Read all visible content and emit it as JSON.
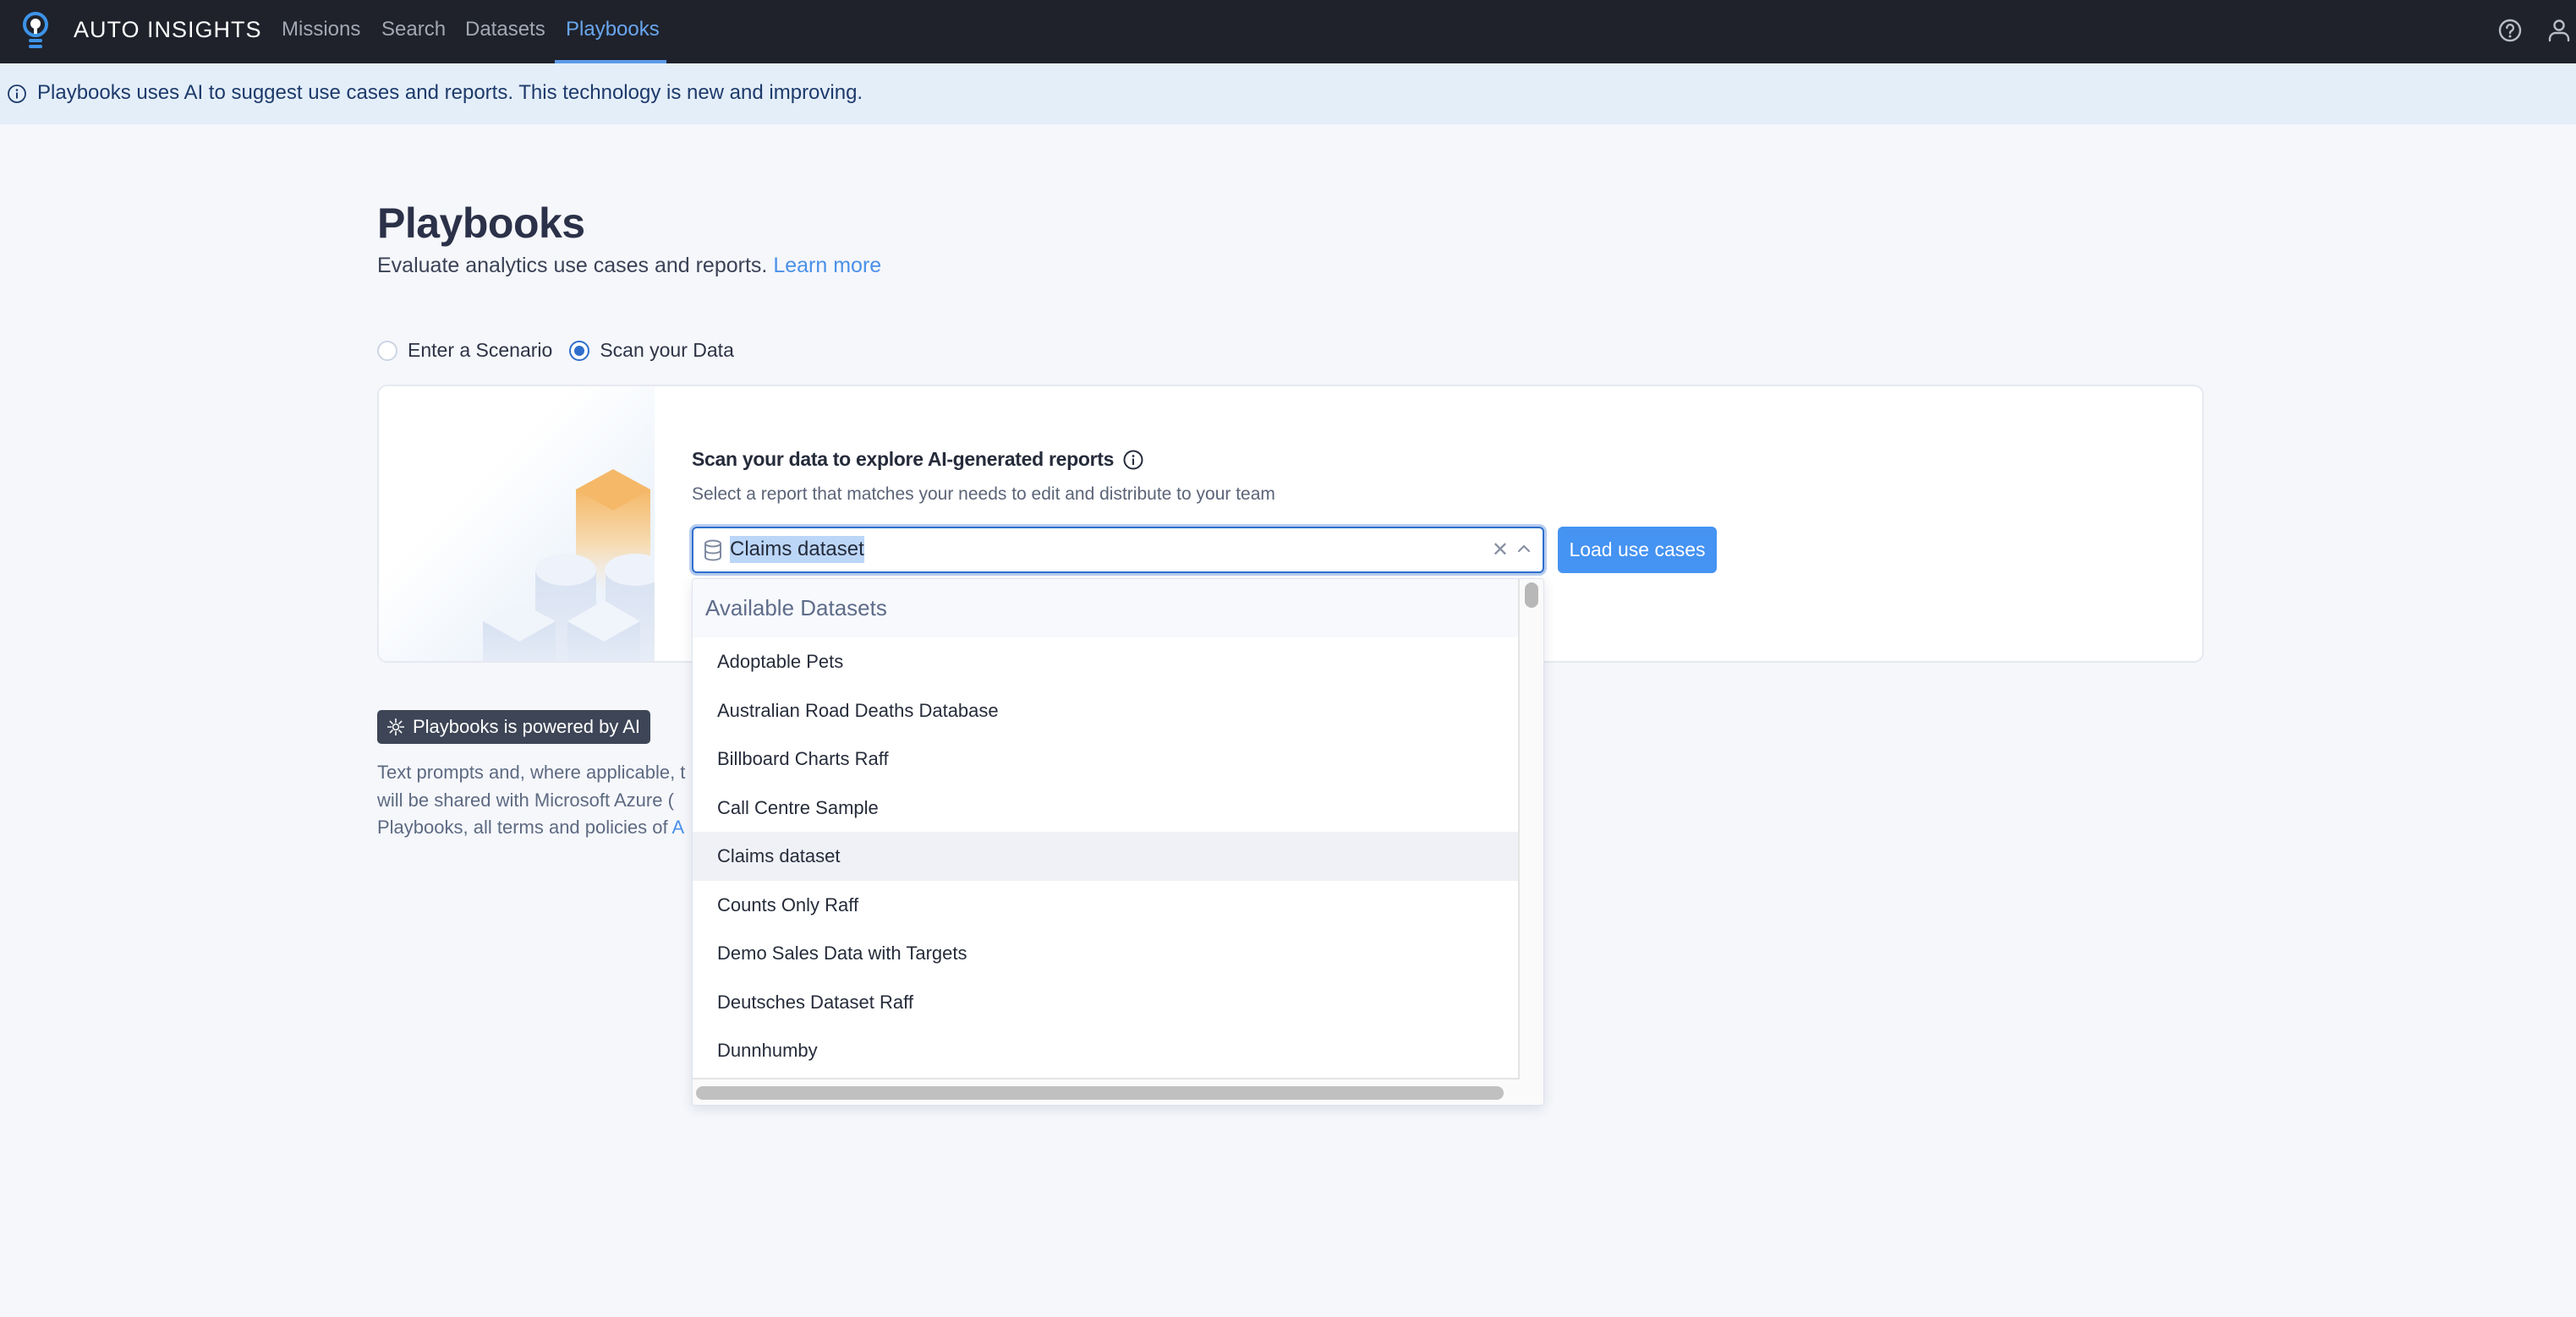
{
  "app": {
    "brand": "AUTO INSIGHTS",
    "logo_icon": "lightbulb-icon"
  },
  "nav": {
    "items": [
      {
        "label": "Missions",
        "active": false
      },
      {
        "label": "Search",
        "active": false
      },
      {
        "label": "Datasets",
        "active": false
      },
      {
        "label": "Playbooks",
        "active": true
      }
    ],
    "right_icons": [
      "help-icon",
      "user-icon"
    ]
  },
  "banner": {
    "icon": "info-icon",
    "text": "Playbooks uses AI to suggest use cases and reports. This technology is new and improving."
  },
  "header": {
    "title": "Playbooks",
    "subtitle": "Evaluate analytics use cases and reports.",
    "learn_more": "Learn more"
  },
  "mode": {
    "options": [
      {
        "label": "Enter a Scenario",
        "checked": false
      },
      {
        "label": "Scan your Data",
        "checked": true
      }
    ]
  },
  "scan": {
    "heading": "Scan your data to explore AI-generated reports",
    "subtext": "Select a report that matches your needs to edit and distribute to your team",
    "select_value": "Claims dataset",
    "load_button": "Load use cases"
  },
  "dropdown": {
    "header": "Available Datasets",
    "items": [
      "Adoptable Pets",
      "Australian Road Deaths Database",
      "Billboard Charts Raff",
      "Call Centre Sample",
      "Claims dataset",
      "Counts Only Raff",
      "Demo Sales Data with Targets",
      "Deutsches Dataset Raff",
      "Dunnhumby"
    ],
    "highlighted": "Claims dataset"
  },
  "ai_notice": {
    "badge": "Playbooks is powered by AI",
    "lines": [
      "Text prompts and, where applicable, t",
      "will be shared with Microsoft Azure (",
      "Playbooks, all terms and policies of "
    ],
    "link_fragment": "A"
  },
  "colors": {
    "topbar": "#1f222b",
    "accent": "#4593f2",
    "active_nav": "#69a6ee",
    "banner_bg": "#e4eef9",
    "page_bg": "#f5f7fb",
    "badge_bg": "#3d4556"
  }
}
